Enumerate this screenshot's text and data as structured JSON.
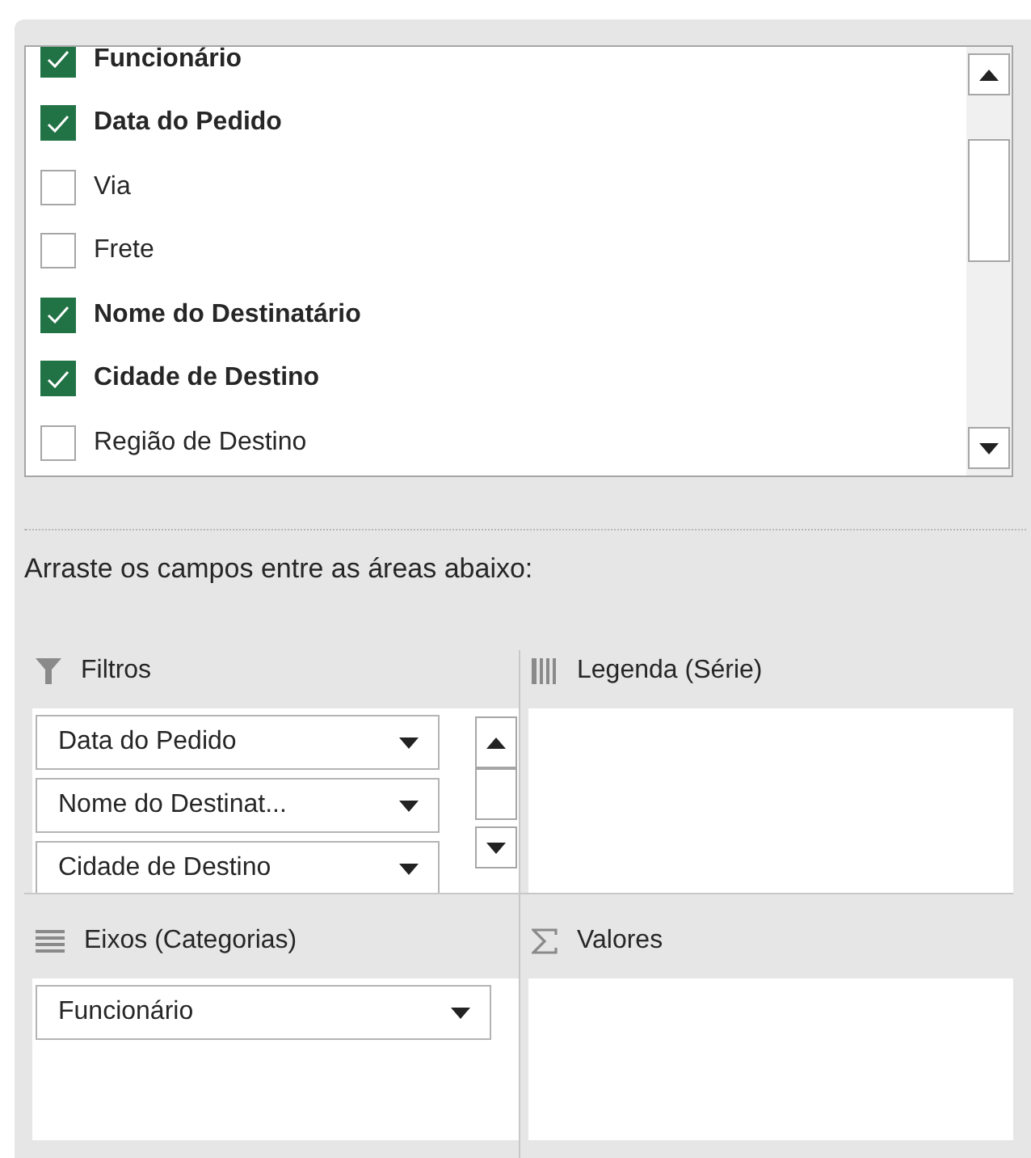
{
  "fields": [
    {
      "label": "Funcionário",
      "checked": true
    },
    {
      "label": "Data do Pedido",
      "checked": true
    },
    {
      "label": "Via",
      "checked": false
    },
    {
      "label": "Frete",
      "checked": false
    },
    {
      "label": "Nome do Destinatário",
      "checked": true
    },
    {
      "label": "Cidade de Destino",
      "checked": true
    },
    {
      "label": "Região de Destino",
      "checked": false
    }
  ],
  "instruction": "Arraste os campos entre as áreas abaixo:",
  "areas": [
    {
      "kind": "filter",
      "title": "Filtros",
      "items": [
        "Data do Pedido",
        "Nome do Destinat...",
        "Cidade de Destino"
      ]
    },
    {
      "kind": "legend",
      "title": "Legenda (Série)"
    },
    {
      "kind": "axis",
      "title": "Eixos (Categorias)",
      "items": [
        "Funcionário"
      ]
    },
    {
      "kind": "values",
      "title": "Valores"
    }
  ]
}
